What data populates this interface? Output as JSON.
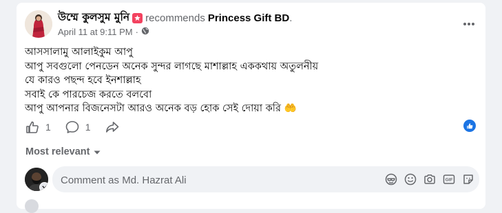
{
  "post": {
    "author": "উম্মে কুলসুম মুনি",
    "recommends_text": "recommends",
    "page_name": "Princess Gift BD",
    "page_suffix": ".",
    "date": "April 11 at 9:11 PM",
    "separator": "·",
    "body_lines": [
      "আসসালামু আলাইকুম আপু",
      "আপু সবগুলো পেনডেন অনেক সুন্দর লাগছে মাশাল্লাহ এককথায় অতুলনীয়",
      "যে কারও পছন্দ হবে ইনশাল্লাহ",
      "সবাই কে পারচেজ করতে বলবো",
      "আপু আপনার বিজনেসটা আরও অনেক বড় হোক সেই দোয়া করি 🤲"
    ]
  },
  "actions": {
    "helpful_count": "1",
    "comment_count": "1"
  },
  "filter": {
    "label": "Most relevant"
  },
  "composer": {
    "placeholder": "Comment as Md. Hazrat Ali"
  },
  "icons": {
    "more": "more-options-icon",
    "globe": "globe-icon",
    "thumbs": "thumbs-up-icon",
    "comment": "comment-icon",
    "share": "share-icon",
    "like_reaction": "like-reaction-icon",
    "caret": "caret-down-icon",
    "avatar_sticker": "avatar-sticker-icon",
    "emoji": "emoji-icon",
    "camera": "camera-icon",
    "gif": "gif-icon",
    "sticker": "sticker-icon"
  },
  "colors": {
    "accent": "#1b74e4",
    "recommend_badge": "#f3425f",
    "secondary_text": "#65676b"
  }
}
